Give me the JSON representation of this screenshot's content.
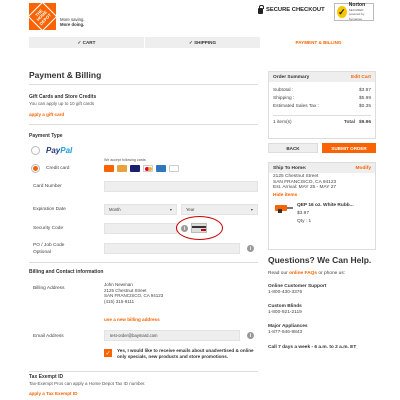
{
  "header": {
    "logo_text": "THE HOME DEPOT",
    "tagline_line1": "More saving.",
    "tagline_line2": "More doing.",
    "secure_checkout": "SECURE CHECKOUT",
    "norton_name": "Norton",
    "norton_secured": "SECURED",
    "norton_by": "powered by Symantec"
  },
  "steps": [
    {
      "label": "✓ CART"
    },
    {
      "label": "✓ SHIPPING"
    },
    {
      "label": "PAYMENT & BILLING"
    }
  ],
  "payment": {
    "title": "Payment & Billing",
    "gift_title": "Gift Cards and Store Credits",
    "gift_sub": "You can apply up to 10 gift cards",
    "apply_gift": "apply a gift card",
    "payment_type": "Payment Type",
    "paypal_1": "Pay",
    "paypal_2": "Pal",
    "credit_card": "Credit card",
    "accept_note": "We accept following cards",
    "cards": [
      {
        "name": "Home Depot",
        "color": "#f96302"
      },
      {
        "name": "Home Depot Commercial",
        "color": "#e8a33d"
      },
      {
        "name": "Visa",
        "color": "#1a1f71"
      },
      {
        "name": "Mastercard",
        "color": "#eb001b"
      },
      {
        "name": "Amex",
        "color": "#2e77bc"
      },
      {
        "name": "Discover",
        "color": "#777777"
      }
    ],
    "card_number": "Card Number",
    "expiration": "Expiration Date",
    "month": "Month",
    "year": "Year",
    "security_code": "Security Code",
    "po_label": "PO / Job Code",
    "optional": "Optional"
  },
  "billing": {
    "title": "Billing and Contact information",
    "address_label": "Billing Address",
    "address_lines": [
      "John Newman",
      "2125 Chestnut Street",
      "SAN FRANCISCO, CA 94123",
      "(415) 315-9111"
    ],
    "new_address": "use a new billing address",
    "email_label": "Email Address",
    "email_value": "test-order@baymard.com",
    "opt_in": "Yes, I would like to receive emails about unadvertised & online only specials, new products and store promotions."
  },
  "tax": {
    "title": "Tax Exempt ID",
    "sub": "Tax-Exempt Pros can apply a Home Depot Tax ID number.",
    "apply": "apply a Tax Exempt ID"
  },
  "summary": {
    "title": "Order Summary",
    "edit": "Edit Cart",
    "rows": [
      {
        "label": "Subtotal :",
        "value": "$3.97"
      },
      {
        "label": "Shipping :",
        "value": "$5.99"
      },
      {
        "label": "Estimated Sales Tax :",
        "value": "$0.35"
      }
    ],
    "items": "1 item(s)",
    "total_label": "Total",
    "total_value": "$9.96"
  },
  "buttons": {
    "back": "BACK",
    "submit": "SUBMIT ORDER"
  },
  "shipping": {
    "title": "Ship To Home:",
    "modify": "Modify",
    "lines": [
      "2125 Chestnut Street",
      "SAN FRANCISCO, CA 94123",
      "Est. Arrival: MAY 25 - MAY 27"
    ],
    "hide": "Hide items",
    "product": "QEP 16 oz. White Rubb...",
    "price": "$3.97",
    "qty": "Qty : 1"
  },
  "help": {
    "title": "Questions? We Can Help.",
    "read_pre": "Read our ",
    "read_link": "online FAQs",
    "read_post": " or phone us:",
    "contacts": [
      {
        "name": "Online Customer Support",
        "phone": "1-800-430-3376"
      },
      {
        "name": "Custom Blinds",
        "phone": "1-800-921-2119"
      },
      {
        "name": "Major Appliances",
        "phone": "1-877-946-9843"
      }
    ],
    "hours": "Call 7 days a week - 6 a.m. to 2 a.m. ET"
  },
  "colors": {
    "accent": "#f96302",
    "highlight_circle": "#cc0000"
  }
}
